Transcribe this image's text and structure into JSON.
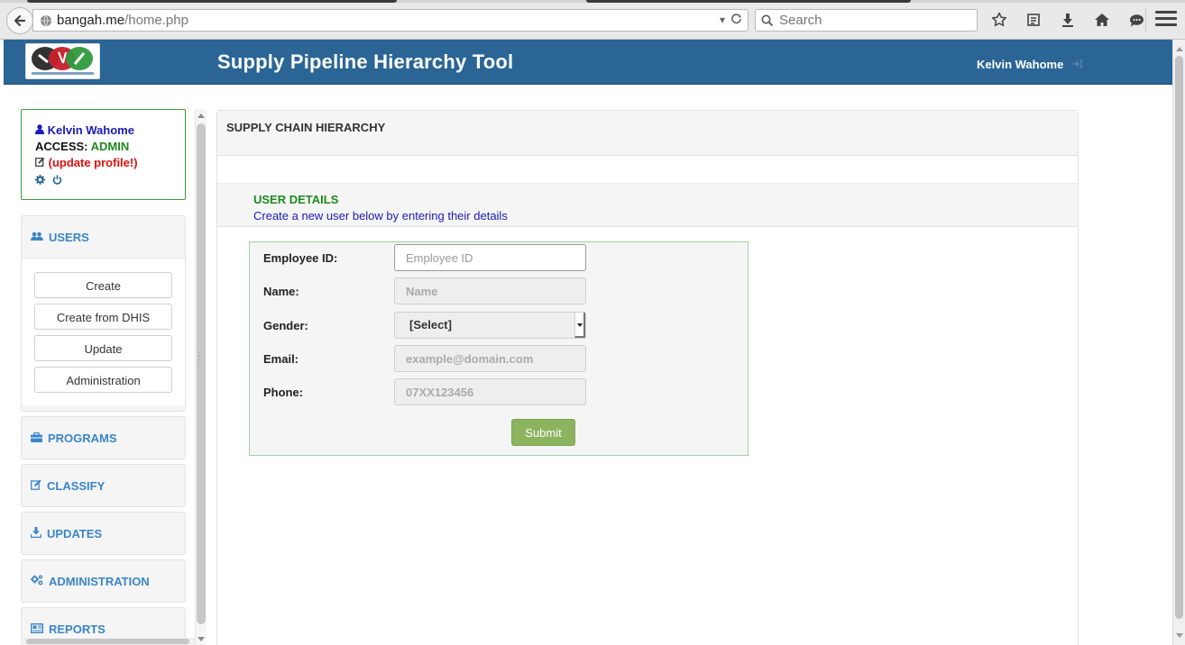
{
  "browser": {
    "url_domain": "bangah.me",
    "url_path": "/home.php",
    "search_placeholder": "Search"
  },
  "header": {
    "title": "Supply Pipeline Hierarchy Tool",
    "user_name": "Kelvin Wahome",
    "bg_color": "#2a6596"
  },
  "profile": {
    "name": "Kelvin Wahome",
    "access_label": "ACCESS:",
    "access_value": "ADMIN",
    "update_label": "(update profile!)"
  },
  "sidebar": {
    "users": {
      "label": "USERS",
      "buttons": [
        "Create",
        "Create from DHIS",
        "Update",
        "Administration"
      ]
    },
    "programs": "PROGRAMS",
    "classify": "CLASSIFY",
    "updates": "UPDATES",
    "administration": "ADMINISTRATION",
    "reports": "REPORTS"
  },
  "main": {
    "header": "SUPPLY CHAIN HIERARCHY",
    "section_title": "USER DETAILS",
    "section_subtitle": "Create a new user below by entering their details",
    "form": {
      "employee_id_label": "Employee ID:",
      "employee_id_placeholder": "Employee ID",
      "name_label": "Name:",
      "name_placeholder": "Name",
      "gender_label": "Gender:",
      "gender_selected": "[Select]",
      "email_label": "Email:",
      "email_placeholder": "example@domain.com",
      "phone_label": "Phone:",
      "phone_placeholder": "07XX123456",
      "submit_label": "Submit"
    }
  },
  "colors": {
    "accent_green": "#1e8a1e",
    "link_blue": "#3a86c8",
    "submit_green": "#8cb35e",
    "alert_red": "#e01010"
  }
}
